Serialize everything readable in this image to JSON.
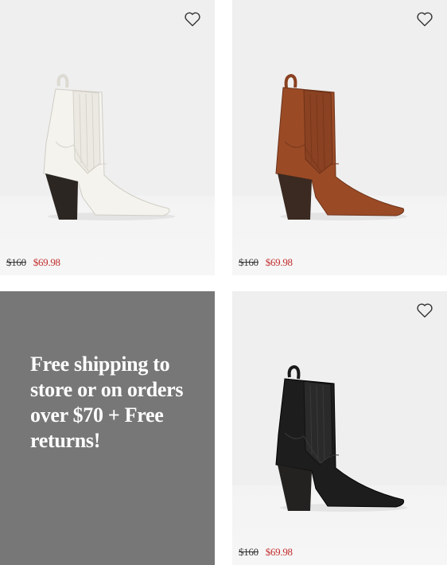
{
  "products": [
    {
      "name": "white-boot",
      "original_price": "$160",
      "sale_price": "$69.98",
      "color": "#f4f3ee",
      "heel": "#2b2622"
    },
    {
      "name": "brown-boot",
      "original_price": "$160",
      "sale_price": "$69.98",
      "color": "#9a4b26",
      "heel": "#3a2a21"
    },
    {
      "name": "black-boot",
      "original_price": "$160",
      "sale_price": "$69.98",
      "color": "#1d1d1d",
      "heel": "#242220"
    }
  ],
  "promo": {
    "text": "Free shipping to store or on orders over $70 + Free returns!",
    "background": "#777777"
  },
  "icons": {
    "wishlist": "heart-outline-icon"
  }
}
